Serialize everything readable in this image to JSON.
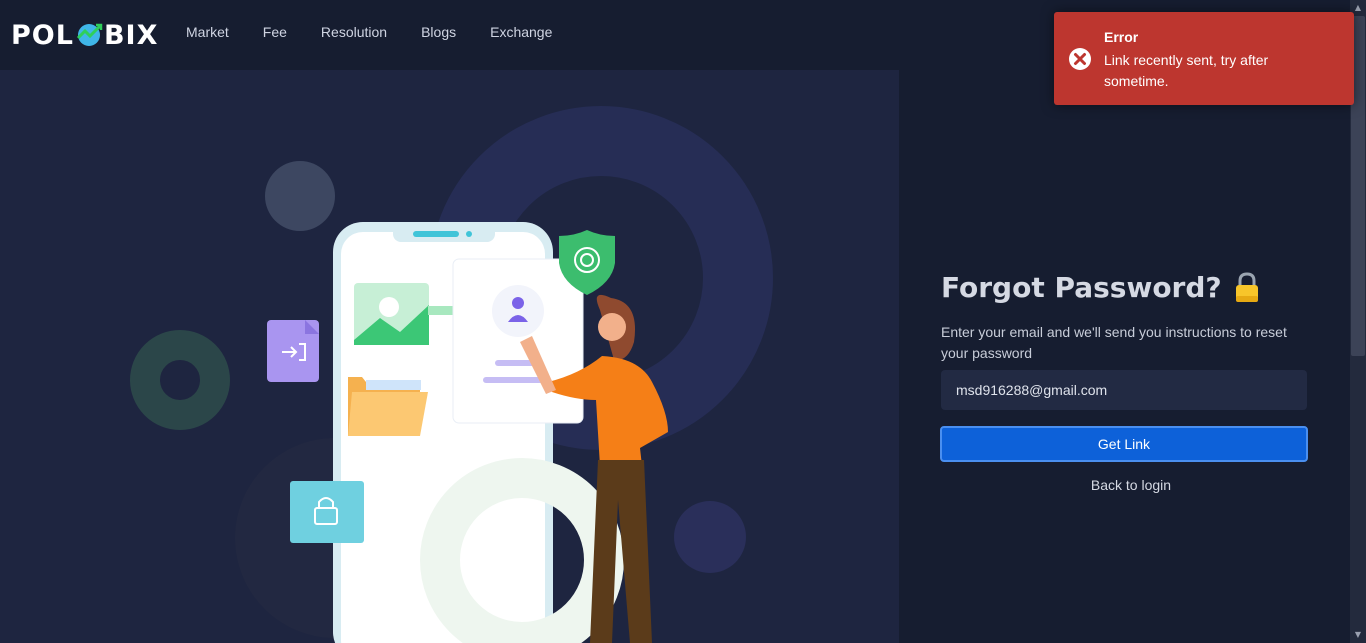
{
  "header": {
    "logo_text_left": "POL",
    "logo_text_right": "BIX",
    "nav": [
      {
        "label": "Market"
      },
      {
        "label": "Fee"
      },
      {
        "label": "Resolution"
      },
      {
        "label": "Blogs"
      },
      {
        "label": "Exchange"
      }
    ]
  },
  "form": {
    "title": "Forgot Password?",
    "description": "Enter your email and we'll send you instructions to reset your password",
    "email_value": "msd916288@gmail.com",
    "submit_label": "Get Link",
    "back_link": "Back to login"
  },
  "toast": {
    "title": "Error",
    "message": "Link recently sent, try after sometime.",
    "color": "#bd362f"
  },
  "colors": {
    "page_bg": "#161d30",
    "illustration_bg": "#1e2540",
    "primary_button": "#0d61d9"
  },
  "icons": {
    "toast": "error-circle-x-icon",
    "title": "lock-icon"
  }
}
